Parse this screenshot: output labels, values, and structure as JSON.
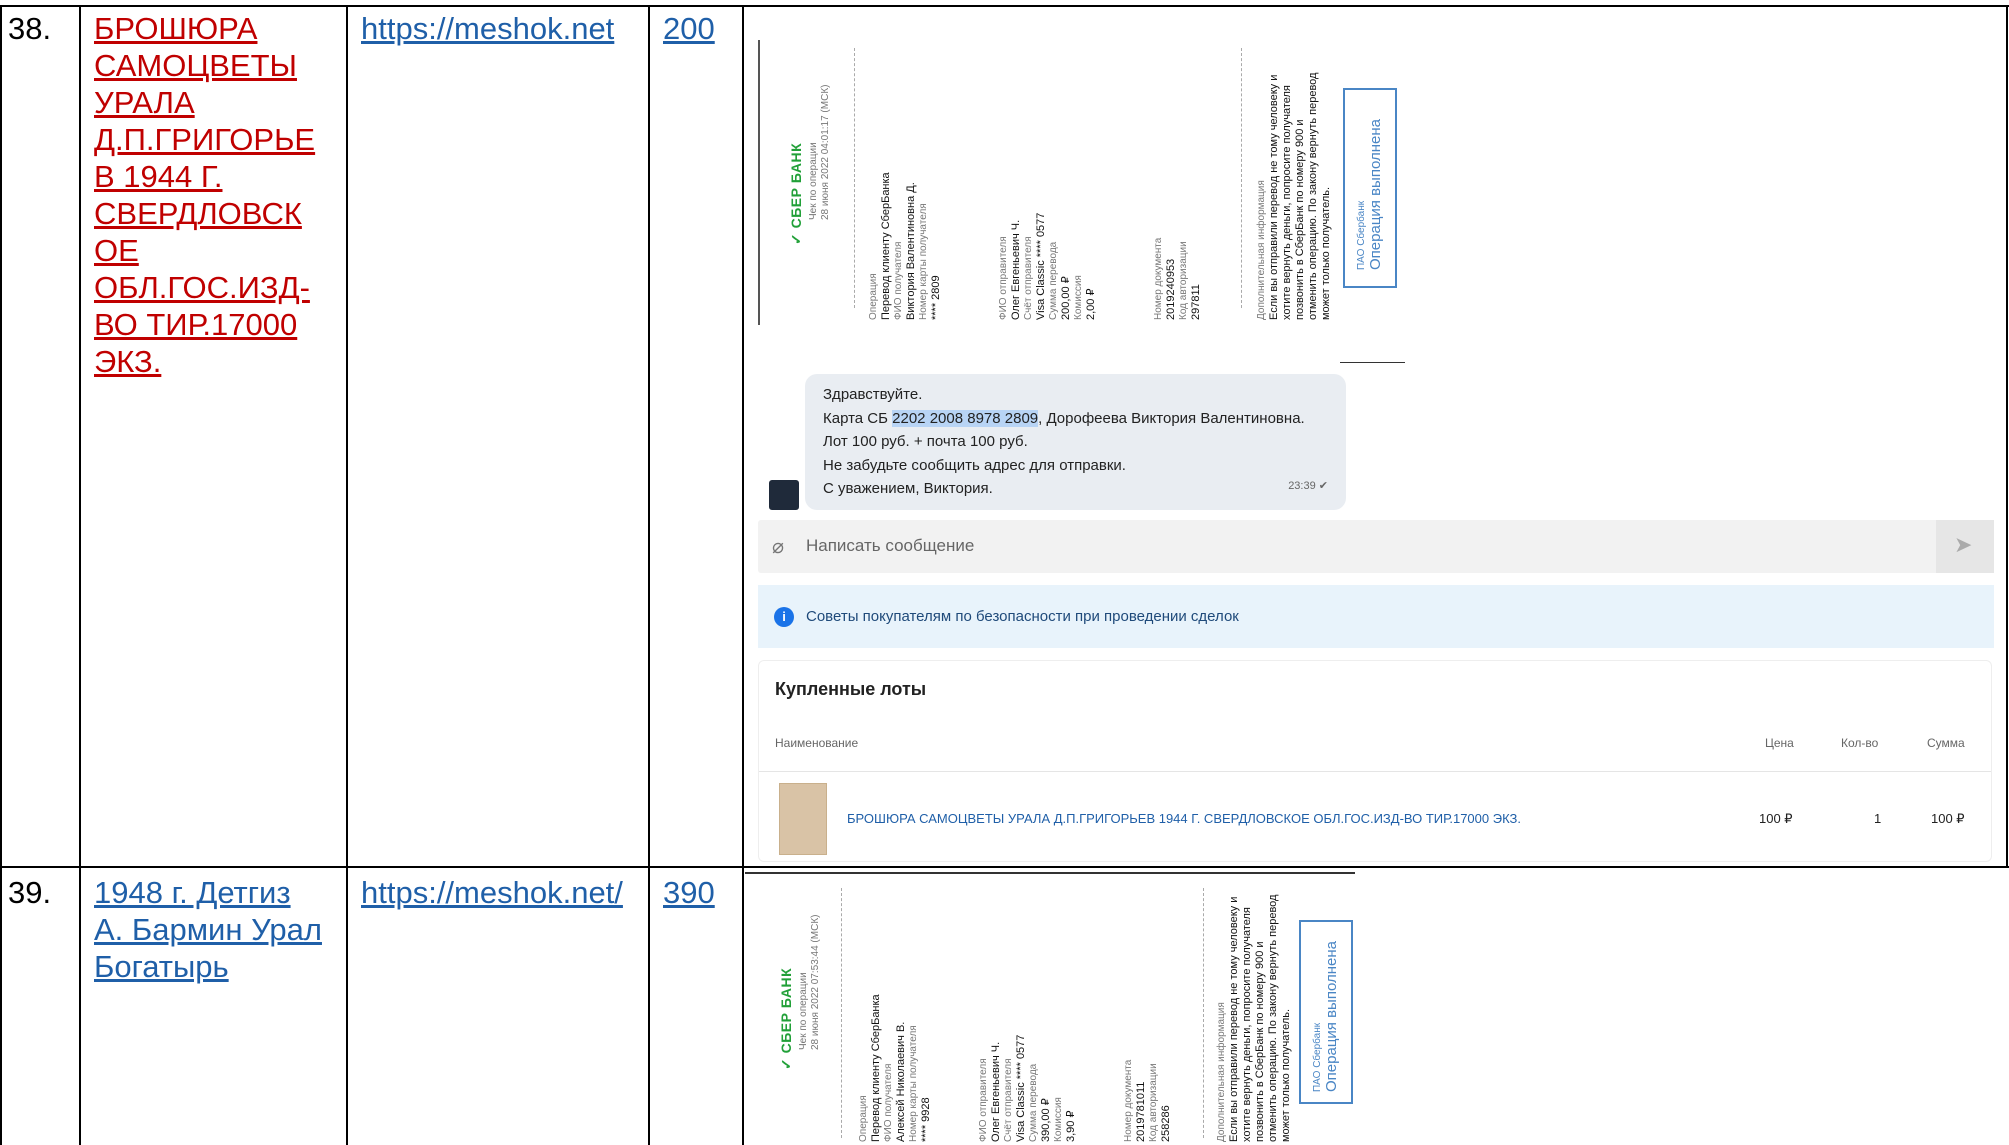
{
  "rows": [
    {
      "num": "38.",
      "title_lines": [
        "БРОШЮРА",
        "САМОЦВЕТЫ",
        "УРАЛА",
        "Д.П.ГРИГОРЬЕ",
        "В 1944 Г.",
        "СВЕРДЛОВСК",
        "ОЕ",
        "ОБЛ.ГОС.ИЗД-",
        "ВО ТИР.17000",
        "ЭКЗ."
      ],
      "url": "https://meshok.net",
      "price": "200"
    },
    {
      "num": "39.",
      "title_lines": [
        "1948 г. Детгиз",
        "А. Бармин Урал",
        "Богатырь"
      ],
      "url": "https://meshok.net/",
      "price": "390"
    }
  ],
  "receipt1": {
    "bank": "СБЕР БАНК",
    "check_label": "Чек по операции",
    "date": "28 июня 2022 04:01:17 (МСК)",
    "op_label": "Операция",
    "op_value": "Перевод клиенту СберБанка",
    "fio_recv_label": "ФИО получателя",
    "fio_recv": "Виктория Валентиновна Д.",
    "card_recv_label": "Номер карты получателя",
    "card_recv": "**** 2809",
    "fio_send_label": "ФИО отправителя",
    "fio_send": "Олег Евгеньевич Ч.",
    "acc_send_label": "Счёт отправителя",
    "acc_send": "Visa Classic **** 0577",
    "sum_label": "Сумма перевода",
    "sum": "200,00 ₽",
    "fee_label": "Комиссия",
    "fee": "2,00 ₽",
    "doc_label": "Номер документа",
    "doc": "2019240953",
    "auth_label": "Код авторизации",
    "auth": "297811",
    "extra_label": "Дополнительная информация",
    "extra_lines": [
      "Если вы отправили перевод не тому человеку и",
      "хотите вернуть деньги, попросите получателя",
      "позвонить в СберБанк по номеру 900 и",
      "отменить операцию. По закону вернуть перевод",
      "может только получатель."
    ],
    "pao": "ПАО Сбербанк",
    "status": "Операция выполнена"
  },
  "receipt2": {
    "bank": "СБЕР БАНК",
    "check_label": "Чек по операции",
    "date": "28 июня 2022 07:53:44 (МСК)",
    "op_label": "Операция",
    "op_value": "Перевод клиенту СберБанка",
    "fio_recv_label": "ФИО получателя",
    "fio_recv": "Алексей Николаевич В.",
    "card_recv_label": "Номер карты получателя",
    "card_recv": "**** 9928",
    "fio_send_label": "ФИО отправителя",
    "fio_send": "Олег Евгеньевич Ч.",
    "acc_send_label": "Счёт отправителя",
    "acc_send": "Visa Classic **** 0577",
    "sum_label": "Сумма перевода",
    "sum": "390,00 ₽",
    "fee_label": "Комиссия",
    "fee": "3,90 ₽",
    "doc_label": "Номер документа",
    "doc": "2019781011",
    "auth_label": "Код авторизации",
    "auth": "258286",
    "extra_label": "Дополнительная информация",
    "extra_lines": [
      "Если вы отправили перевод не тому человеку и",
      "хотите вернуть деньги, попросите получателя",
      "позвонить в СберБанк по номеру 900 и",
      "отменить операцию. По закону вернуть перевод",
      "может только получатель."
    ],
    "pao": "ПАО Сбербанк",
    "status": "Операция выполнена"
  },
  "chat": {
    "greeting": "Здравствуйте.",
    "card_prefix": "Карта СБ ",
    "card_number": "2202 2008 8978 2809",
    "card_suffix": ", Дорофеева Виктория Валентиновна.",
    "lot_line": "Лот 100 руб. + почта 100 руб.",
    "address_line": "Не забудьте сообщить адрес для отправки.",
    "sign_line": "С уважением, Виктория.",
    "time": "23:39",
    "input_placeholder": "Написать сообщение",
    "tips": "Советы покупателям по безопасности при проведении сделок",
    "purchased_title": "Купленные лоты",
    "col_name": "Наименование",
    "col_price": "Цена",
    "col_qty": "Кол-во",
    "col_sum": "Сумма",
    "item_name": "БРОШЮРА САМОЦВЕТЫ УРАЛА Д.П.ГРИГОРЬЕВ 1944 Г. СВЕРДЛОВСКОЕ ОБЛ.ГОС.ИЗД-ВО ТИР.17000 ЭКЗ.",
    "item_price": "100 ₽",
    "item_qty": "1",
    "item_sum": "100 ₽"
  },
  "colors": {
    "red_link": "#c00000",
    "blue_link": "#1f5fa8",
    "sber_green": "#21a038",
    "chat_bubble": "#e9edf2",
    "tips_bg": "#e8f3fb",
    "info_icon": "#1a73e8"
  }
}
